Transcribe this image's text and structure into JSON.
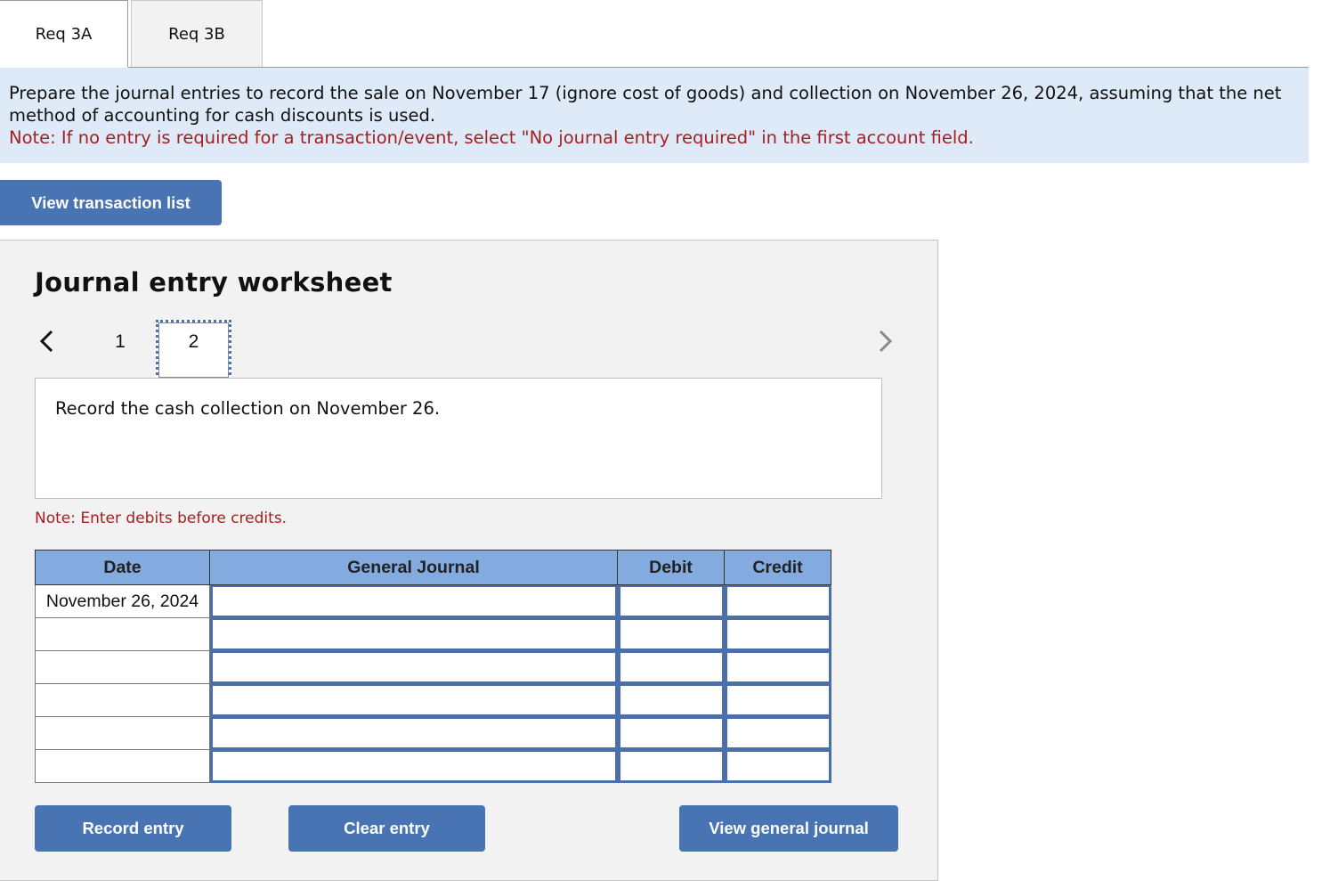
{
  "tabs": [
    {
      "label": "Req 3A",
      "active": true
    },
    {
      "label": "Req 3B",
      "active": false
    }
  ],
  "instructions": {
    "main": "Prepare the journal entries to record the sale on November 17 (ignore cost of goods) and collection on November 26, 2024, assuming that the net method of accounting for cash discounts is used.",
    "note": "Note: If no entry is required for a transaction/event, select \"No journal entry required\" in the first account field."
  },
  "buttons": {
    "view_transaction_list": "View transaction list",
    "record_entry": "Record entry",
    "clear_entry": "Clear entry",
    "view_general_journal": "View general journal"
  },
  "worksheet": {
    "title": "Journal entry worksheet",
    "pages": [
      "1",
      "2"
    ],
    "current_page": "2",
    "prev_icon": "chevron-left-icon",
    "next_icon": "chevron-right-icon",
    "description": "Record the cash collection on November 26.",
    "note": "Note: Enter debits before credits.",
    "table": {
      "headers": {
        "date": "Date",
        "general_journal": "General Journal",
        "debit": "Debit",
        "credit": "Credit"
      },
      "rows": [
        {
          "date": "November 26, 2024",
          "account": "",
          "debit": "",
          "credit": ""
        },
        {
          "date": "",
          "account": "",
          "debit": "",
          "credit": ""
        },
        {
          "date": "",
          "account": "",
          "debit": "",
          "credit": ""
        },
        {
          "date": "",
          "account": "",
          "debit": "",
          "credit": ""
        },
        {
          "date": "",
          "account": "",
          "debit": "",
          "credit": ""
        },
        {
          "date": "",
          "account": "",
          "debit": "",
          "credit": ""
        }
      ]
    }
  },
  "colors": {
    "accent_button": "#4874b4",
    "header_fill": "#84abe0",
    "instruction_bg": "#deeaf7",
    "note_red": "#a51f1f",
    "panel_bg": "#f2f2f2"
  }
}
